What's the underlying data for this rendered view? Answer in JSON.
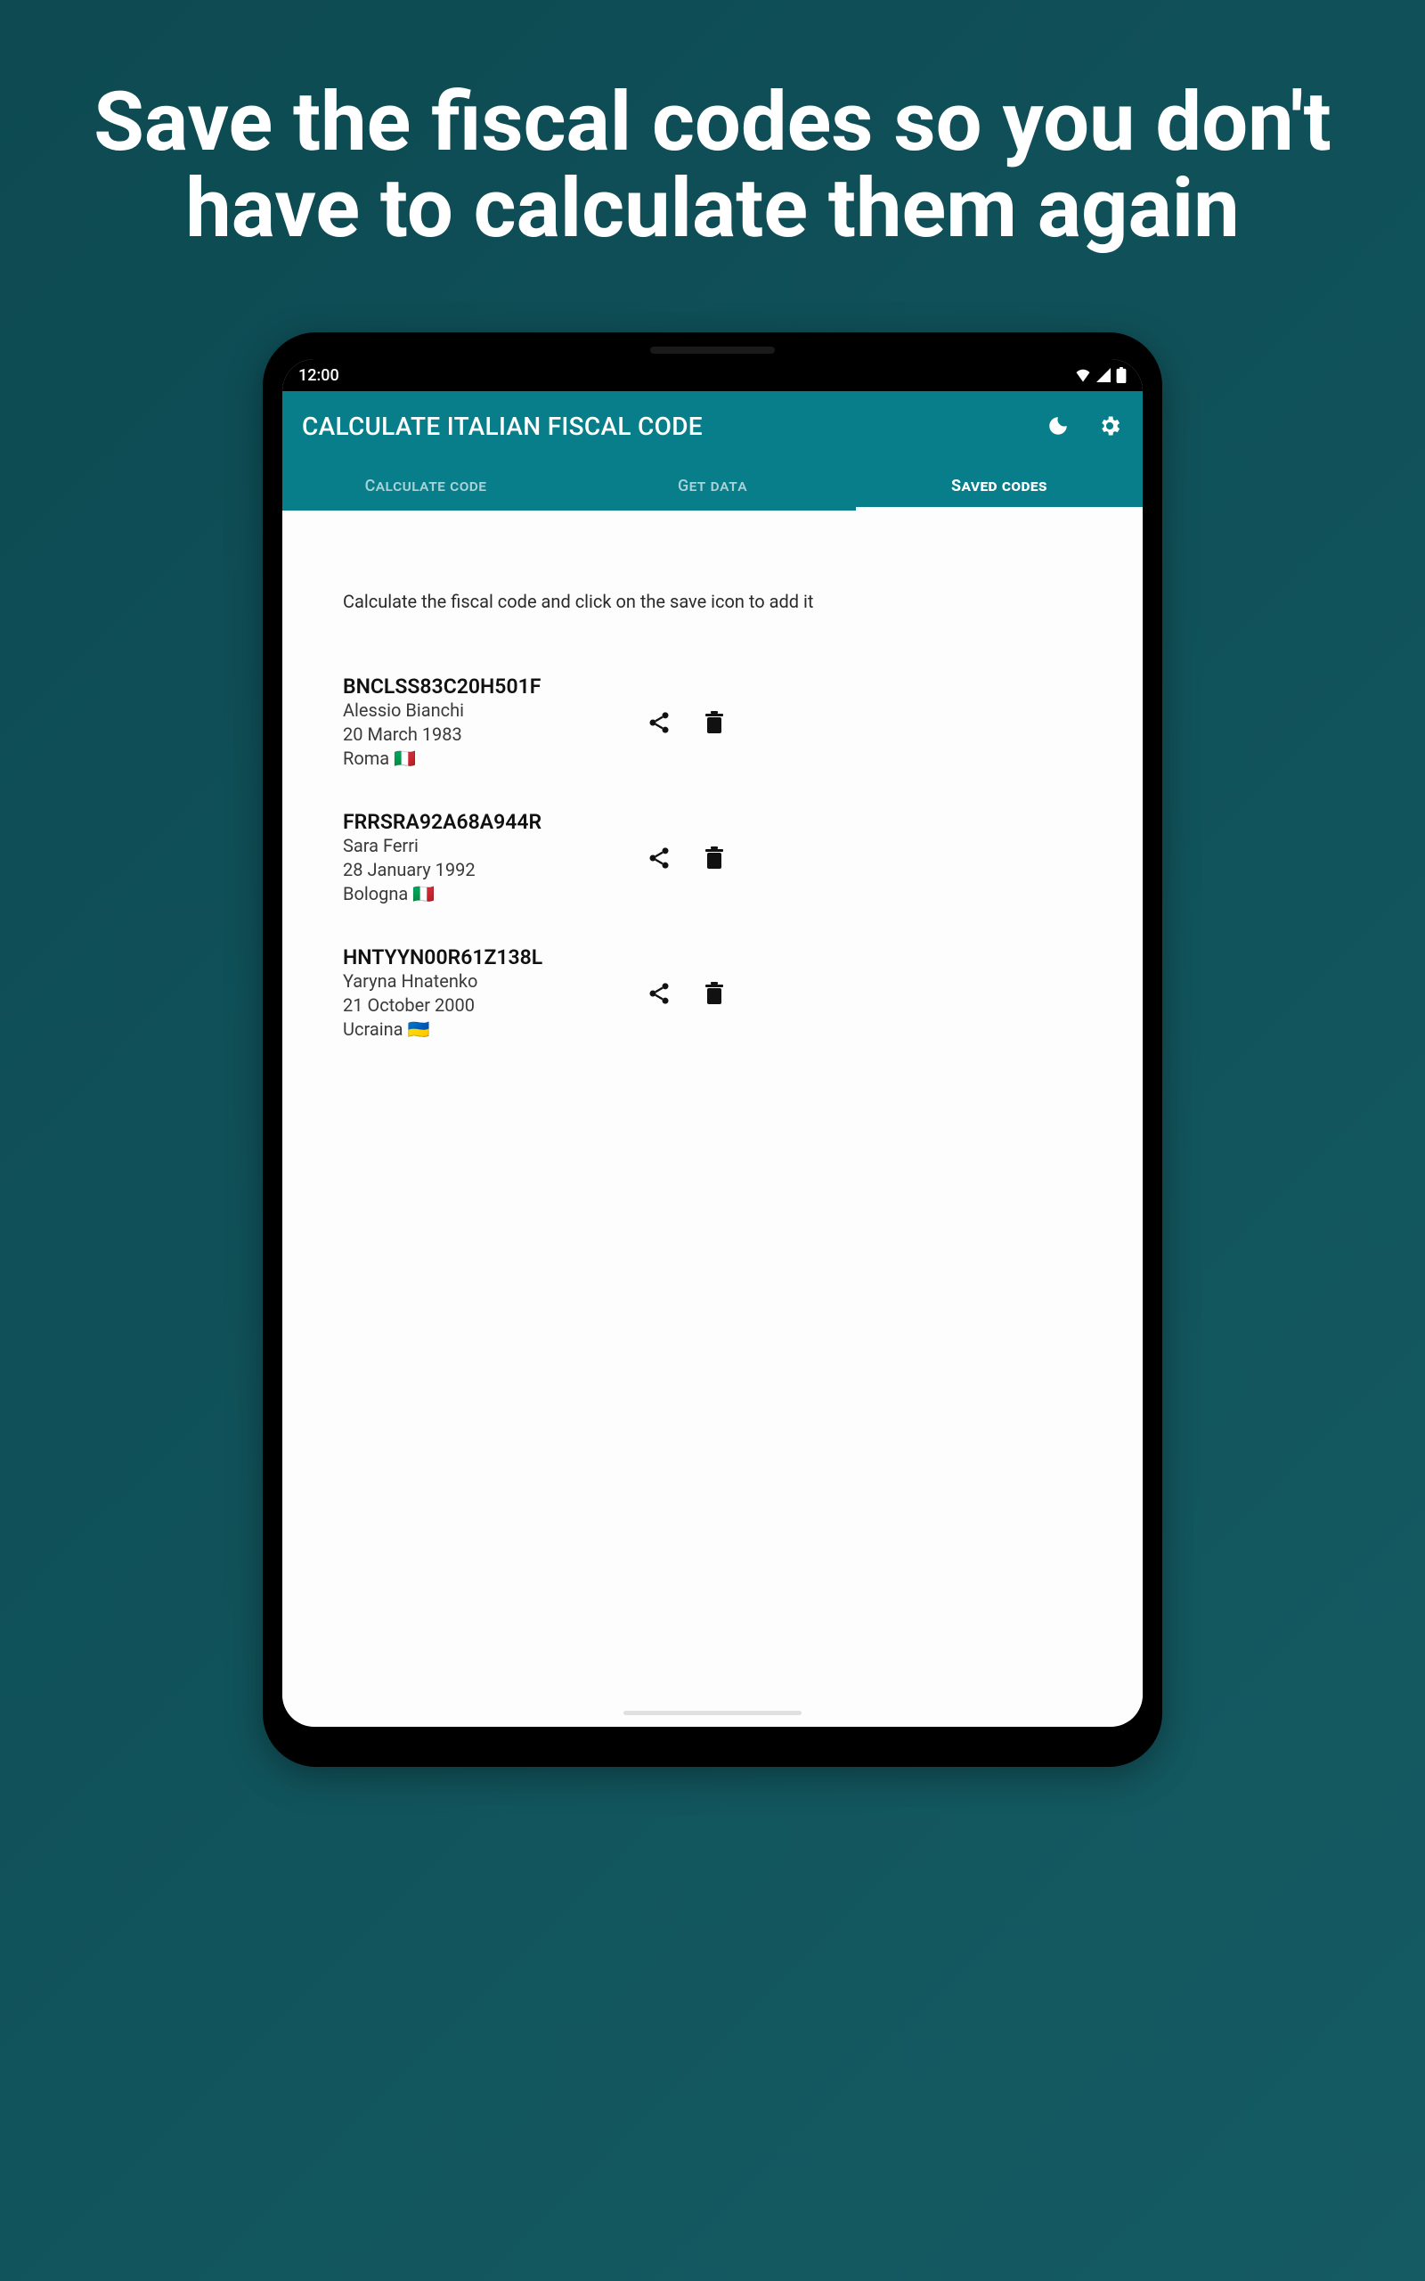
{
  "headline": "Save the fiscal codes so you don't have to calculate them again",
  "status": {
    "time": "12:00"
  },
  "appbar": {
    "title": "CALCULATE ITALIAN FISCAL CODE"
  },
  "tabs": {
    "calculate": "Calculate code",
    "getdata": "Get data",
    "saved": "Saved codes"
  },
  "hint": "Calculate the fiscal code and click on the save icon to add it",
  "items": [
    {
      "code": "BNCLSS83C20H501F",
      "name": "Alessio Bianchi",
      "dob": "20 March 1983",
      "place": "Roma 🇮🇹"
    },
    {
      "code": "FRRSRA92A68A944R",
      "name": "Sara Ferri",
      "dob": "28 January 1992",
      "place": "Bologna 🇮🇹"
    },
    {
      "code": "HNTYYN00R61Z138L",
      "name": "Yaryna Hnatenko",
      "dob": "21 October 2000",
      "place": "Ucraina 🇺🇦"
    }
  ]
}
